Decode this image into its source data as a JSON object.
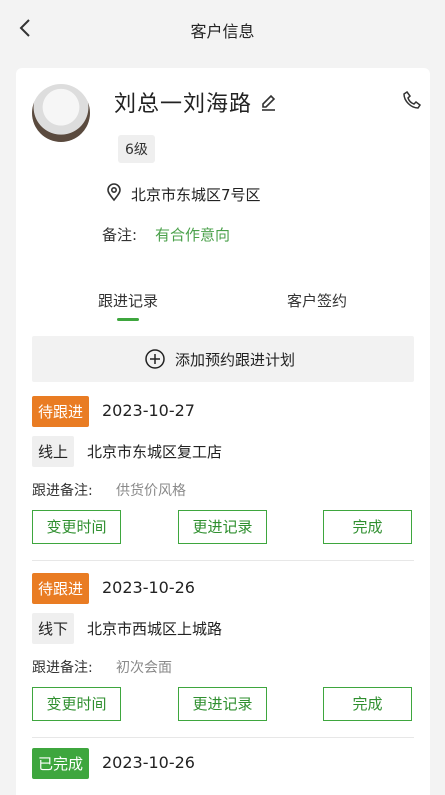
{
  "header": {
    "title": "客户信息"
  },
  "customer": {
    "name": "刘总一刘海路",
    "level": "6级",
    "address": "北京市东城区7号区",
    "note_label": "备注:",
    "note_value": "有合作意向"
  },
  "tabs": [
    {
      "label": "跟进记录",
      "active": true
    },
    {
      "label": "客户签约",
      "active": false
    }
  ],
  "add_plan": {
    "label": "添加预约跟进计划"
  },
  "records": [
    {
      "status": "待跟进",
      "date": "2023-10-27",
      "mode": "线上",
      "place": "北京市东城区复工店",
      "followup_label": "跟进备注:",
      "followup_value": "供货价风格",
      "buttons": [
        "变更时间",
        "更进记录",
        "完成"
      ]
    },
    {
      "status": "待跟进",
      "date": "2023-10-26",
      "mode": "线下",
      "place": "北京市西城区上城路",
      "followup_label": "跟进备注:",
      "followup_value": "初次会面",
      "buttons": [
        "变更时间",
        "更进记录",
        "完成"
      ]
    },
    {
      "status": "已完成",
      "date": "2023-10-26"
    }
  ],
  "colors": {
    "accent": "#3ea63e",
    "pending": "#e97c23",
    "note": "#4aa04a"
  },
  "icons": [
    "back-icon",
    "edit-icon",
    "phone-icon",
    "location-icon",
    "plus-circle-icon"
  ]
}
